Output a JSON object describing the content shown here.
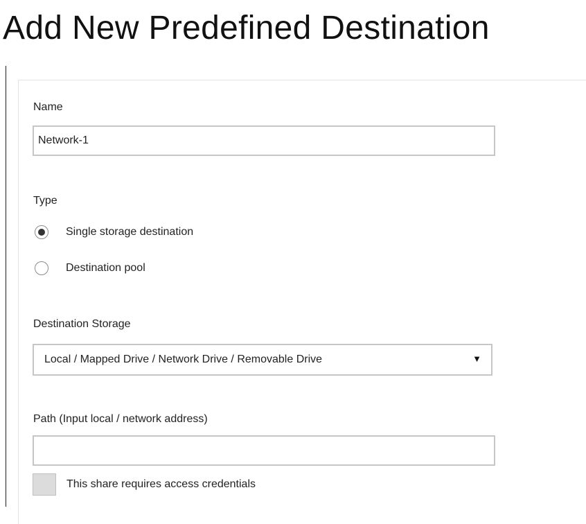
{
  "page": {
    "title": "Add New Predefined Destination"
  },
  "form": {
    "name": {
      "label": "Name",
      "value": "Network-1",
      "placeholder": ""
    },
    "type": {
      "label": "Type",
      "options": [
        {
          "label": "Single storage destination",
          "selected": true
        },
        {
          "label": "Destination pool",
          "selected": false
        }
      ]
    },
    "destination_storage": {
      "label": "Destination Storage",
      "selected_value": "Local / Mapped Drive / Network Drive / Removable Drive",
      "arrow_glyph": "▼"
    },
    "path": {
      "label": "Path (Input local / network address)",
      "value": "",
      "placeholder": ""
    },
    "credentials": {
      "label": "This share requires access credentials",
      "checked": false
    }
  }
}
